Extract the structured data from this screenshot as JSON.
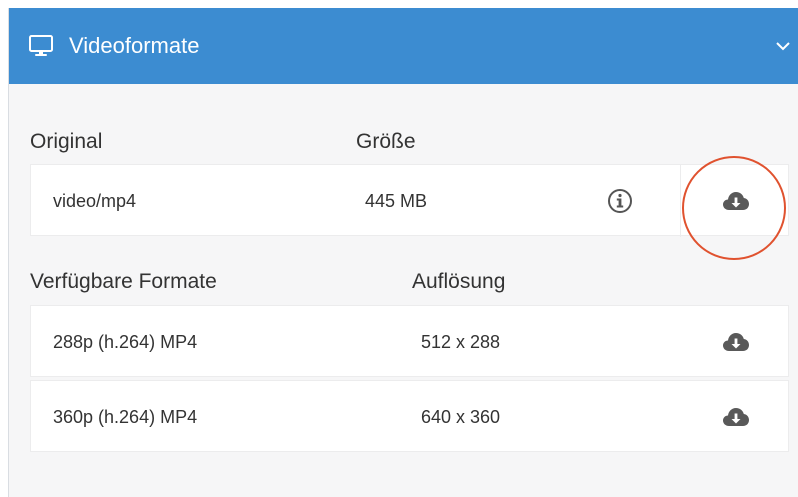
{
  "header": {
    "title": "Videoformate",
    "icon": "monitor-icon",
    "toggle_icon": "chevron-down-icon",
    "bg_color": "#3c8cd1"
  },
  "original": {
    "label": "Original",
    "size_label": "Größe",
    "row": {
      "type": "video/mp4",
      "size": "445 MB",
      "info_icon": "info-icon",
      "download_icon": "cloud-download-icon"
    }
  },
  "formats": {
    "label": "Verfügbare Formate",
    "resolution_label": "Auflösung",
    "rows": [
      {
        "name": "288p (h.264) MP4",
        "resolution": "512 x 288",
        "download_icon": "cloud-download-icon"
      },
      {
        "name": "360p (h.264) MP4",
        "resolution": "640 x 360",
        "download_icon": "cloud-download-icon"
      }
    ]
  },
  "highlight_color": "#e0522f"
}
